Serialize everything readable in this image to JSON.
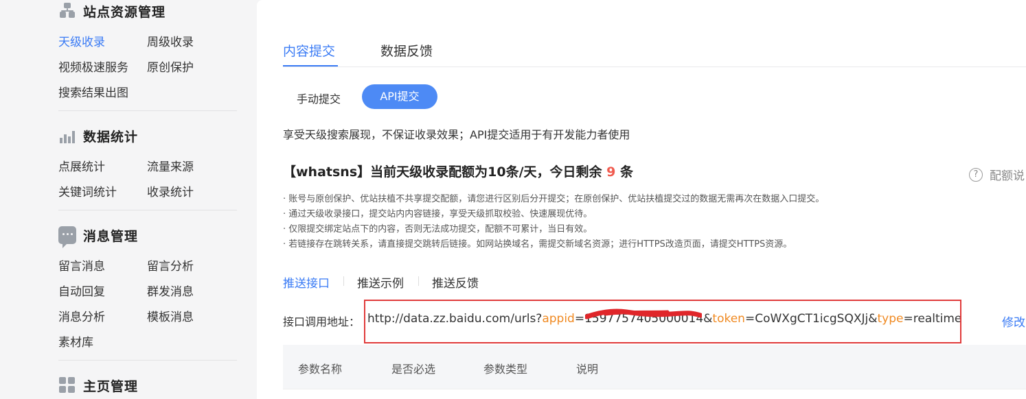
{
  "sidebar": {
    "sections": [
      {
        "title": "站点资源管理",
        "icon": "sitemap-icon",
        "items": [
          "天级收录",
          "周级收录",
          "视频极速服务",
          "原创保护",
          "搜索结果出图"
        ],
        "active": 0
      },
      {
        "title": "数据统计",
        "icon": "bar-chart-icon",
        "items": [
          "点展统计",
          "流量来源",
          "关键词统计",
          "收录统计"
        ]
      },
      {
        "title": "消息管理",
        "icon": "chat-icon",
        "items": [
          "留言消息",
          "留言分析",
          "自动回复",
          "群发消息",
          "消息分析",
          "模板消息",
          "素材库"
        ]
      },
      {
        "title": "主页管理",
        "icon": "grid-icon",
        "items": []
      }
    ]
  },
  "main": {
    "tabs": [
      "内容提交",
      "数据反馈"
    ],
    "active_tab": 0,
    "subtabs": [
      "手动提交",
      "API提交"
    ],
    "active_subtab": 1,
    "description": "享受天级搜索展现，不保证收录效果；API提交适用于有开发能力者使用",
    "quota": {
      "prefix": "【whatsns】当前天级收录配额为10条/天，今日剩余 ",
      "remaining": "9",
      "suffix": " 条",
      "help_label": "配额说"
    },
    "notes": [
      "· 账号与原创保护、优站扶植不共享提交配额，请您进行区别后分开提交；在原创保护、优站扶植提交过的数据无需再次在数据入口提交。",
      "· 通过天级收录接口，提交站内内容链接，享受天级抓取校验、快速展现优待。",
      "· 仅限提交绑定站点下的内容，否则无法成功提交，配额不可累计，当日有效。",
      "· 若链接存在跳转关系，请直接提交跳转后链接。如网站换域名，需提交新域名资源；进行HTTPS改造页面，请提交HTTPS资源。"
    ],
    "push_tabs": [
      "推送接口",
      "推送示例",
      "推送反馈"
    ],
    "active_push_tab": 0,
    "api": {
      "label": "接口调用地址：",
      "url_base": "http://data.zz.baidu.com/urls?",
      "key_appid": "appid",
      "eq1": "=",
      "appid_value": "1597757405000014",
      "amp1": "&",
      "key_token": "token",
      "eq2": "=",
      "token_value": "CoWXgCT1icgSQXJj",
      "amp2": "&",
      "key_type": "type",
      "eq3": "=",
      "type_value": "realtime",
      "modify_label": "修改"
    },
    "table_headers": [
      "参数名称",
      "是否必选",
      "参数类型",
      "说明"
    ]
  },
  "colors": {
    "accent": "#3a7bf5",
    "alert": "#f05a4e",
    "param_key": "#f08a22",
    "highlight_border": "#e03a3a"
  }
}
